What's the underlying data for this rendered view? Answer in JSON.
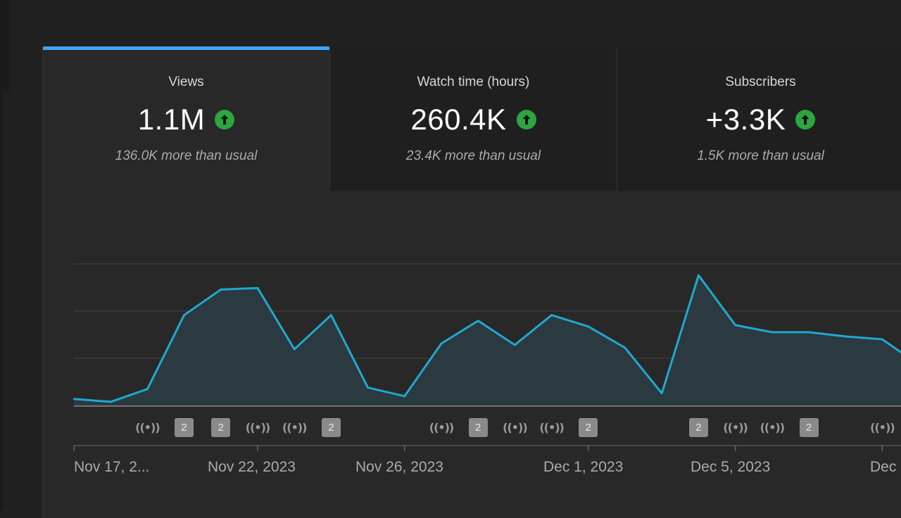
{
  "metrics": [
    {
      "label": "Views",
      "value": "1.1M",
      "trend_icon": "arrow-up-circle-icon",
      "note": "136.0K more than usual"
    },
    {
      "label": "Watch time (hours)",
      "value": "260.4K",
      "trend_icon": "arrow-up-circle-icon",
      "note": "23.4K more than usual"
    },
    {
      "label": "Subscribers",
      "value": "+3.3K",
      "trend_icon": "arrow-up-circle-icon",
      "note": "1.5K more than usual"
    }
  ],
  "colors": {
    "accent": "#3ea6ff",
    "line": "#1fa8d0",
    "trend_up": "#2ba640",
    "background": "#282828"
  },
  "chart_data": {
    "type": "area",
    "metric": "Views",
    "y_scale": "relative (no y tick labels shown)",
    "grid": "horizontal",
    "x": [
      "Nov 17",
      "Nov 18",
      "Nov 19",
      "Nov 20",
      "Nov 21",
      "Nov 22",
      "Nov 23",
      "Nov 24",
      "Nov 25",
      "Nov 26",
      "Nov 27",
      "Nov 28",
      "Nov 29",
      "Nov 30",
      "Dec 1",
      "Dec 2",
      "Dec 3",
      "Dec 4",
      "Dec 5",
      "Dec 6",
      "Dec 7",
      "Dec 8",
      "Dec 9",
      "Dec 10"
    ],
    "values": [
      0.05,
      0.03,
      0.12,
      0.64,
      0.82,
      0.83,
      0.4,
      0.64,
      0.13,
      0.07,
      0.44,
      0.6,
      0.43,
      0.64,
      0.56,
      0.41,
      0.09,
      0.92,
      0.57,
      0.52,
      0.52,
      0.49,
      0.47,
      0.29
    ],
    "x_tick_labels": [
      "Nov 17, 2...",
      "Nov 22, 2023",
      "Nov 26, 2023",
      "Dec 1, 2023",
      "Dec 5, 2023",
      "Dec"
    ],
    "markers": [
      {
        "day": "Nov 19",
        "kind": "live",
        "icon": "live-stream-icon"
      },
      {
        "day": "Nov 20",
        "kind": "count",
        "text": "2",
        "icon": "upload-count-badge"
      },
      {
        "day": "Nov 21",
        "kind": "count",
        "text": "2",
        "icon": "upload-count-badge"
      },
      {
        "day": "Nov 22",
        "kind": "live",
        "icon": "live-stream-icon"
      },
      {
        "day": "Nov 23",
        "kind": "live",
        "icon": "live-stream-icon"
      },
      {
        "day": "Nov 24",
        "kind": "count",
        "text": "2",
        "icon": "upload-count-badge"
      },
      {
        "day": "Nov 27",
        "kind": "live",
        "icon": "live-stream-icon"
      },
      {
        "day": "Nov 28",
        "kind": "count",
        "text": "2",
        "icon": "upload-count-badge"
      },
      {
        "day": "Nov 29",
        "kind": "live",
        "icon": "live-stream-icon"
      },
      {
        "day": "Nov 30",
        "kind": "live",
        "icon": "live-stream-icon"
      },
      {
        "day": "Dec 1",
        "kind": "count",
        "text": "2",
        "icon": "upload-count-badge"
      },
      {
        "day": "Dec 4",
        "kind": "count",
        "text": "2",
        "icon": "upload-count-badge"
      },
      {
        "day": "Dec 5",
        "kind": "live",
        "icon": "live-stream-icon"
      },
      {
        "day": "Dec 6",
        "kind": "live",
        "icon": "live-stream-icon"
      },
      {
        "day": "Dec 7",
        "kind": "count",
        "text": "2",
        "icon": "upload-count-badge"
      },
      {
        "day": "Dec 9",
        "kind": "live",
        "icon": "live-stream-icon"
      }
    ],
    "live_glyph": "((•))"
  }
}
